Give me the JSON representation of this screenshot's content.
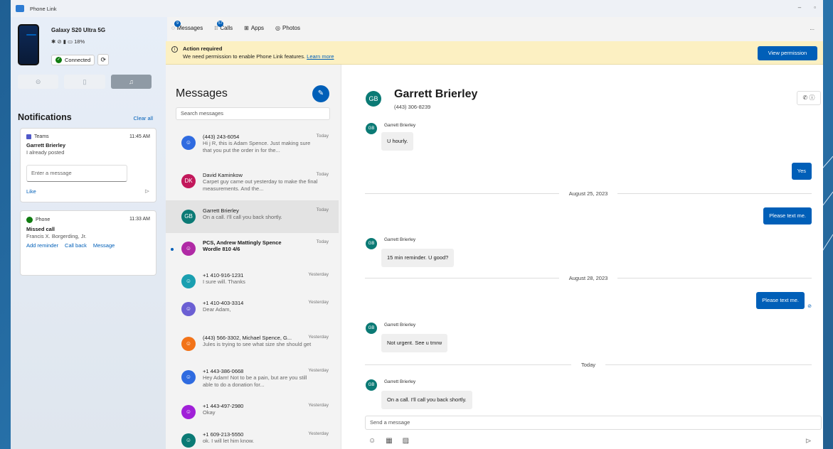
{
  "window": {
    "title": "Phone Link",
    "controls": [
      "–",
      "▫"
    ]
  },
  "device": {
    "name": "Galaxy S20 Ultra 5G",
    "status": "✱ ⊘ ▮ ▭ 18%",
    "connected_label": "Connected",
    "refresh_icon": "⟳",
    "modes": [
      "⊝",
      "▯",
      "♫"
    ]
  },
  "notifications": {
    "title": "Notifications",
    "clear_all": "Clear all",
    "teams": {
      "app": "Teams",
      "time": "11:45 AM",
      "sender": "Garrett Brierley",
      "body": "I already posted",
      "input_placeholder": "Enter a message",
      "like": "Like"
    },
    "phone": {
      "app": "Phone",
      "time": "11:33 AM",
      "title": "Missed call",
      "caller": "Francis X. Borgerding, Jr.",
      "actions": [
        "Add reminder",
        "Call back",
        "Message"
      ]
    }
  },
  "nav": {
    "tabs": [
      {
        "label": "Messages",
        "icon": "💬",
        "badge": "9"
      },
      {
        "label": "Calls",
        "icon": "⁝⁝",
        "badge": "57"
      },
      {
        "label": "Apps",
        "icon": "⊞",
        "badge": ""
      },
      {
        "label": "Photos",
        "icon": "◎",
        "badge": ""
      }
    ],
    "more": "..."
  },
  "banner": {
    "title": "Action required",
    "text": "We need permission to enable Phone Link features.",
    "link": "Learn more",
    "button": "View permission"
  },
  "messages": {
    "heading": "Messages",
    "search_placeholder": "Search messages",
    "conversations": [
      {
        "name": "(443) 243-6054",
        "preview": "Hi j R, this is Adam Spence. Just making sure that you put the order in for the...",
        "date": "Today",
        "avatar": "👤",
        "color": "#2f6be0"
      },
      {
        "name": "David Kaminkow",
        "preview": "Carpet guy came out yesterday to make the final measurements. And the...",
        "date": "Today",
        "avatar": "DK",
        "color": "#c2185b"
      },
      {
        "name": "Garrett Brierley",
        "preview": "On a call.  I'll call you back shortly.",
        "date": "Today",
        "avatar": "GB",
        "color": "#0b7a75"
      },
      {
        "name": "PCS, Andrew Mattingly Spence",
        "preview": "Wordle 810 4/6",
        "date": "Today",
        "avatar": "👥",
        "color": "#b02aa5"
      },
      {
        "name": "+1 410-916-1231",
        "preview": "I sure will. Thanks",
        "date": "Yesterday",
        "avatar": "👤",
        "color": "#1a9fb0"
      },
      {
        "name": "+1 410-403-3314",
        "preview": "Dear Adam,",
        "date": "Yesterday",
        "avatar": "👤",
        "color": "#6b5fd3"
      },
      {
        "name": "(443) 566-3302, Michael Spence, G...",
        "preview": "Jules is trying to see what size she should get",
        "date": "Yesterday",
        "avatar": "👥",
        "color": "#f27318"
      },
      {
        "name": "+1 443-386-0668",
        "preview": "Hey Adam! Not to be a pain, but are you still able to do a donation for...",
        "date": "Yesterday",
        "avatar": "👤",
        "color": "#2f6be0"
      },
      {
        "name": "+1 443-497-2980",
        "preview": "Okay",
        "date": "Yesterday",
        "avatar": "👤",
        "color": "#a020d8"
      },
      {
        "name": "+1 609-213-5550",
        "preview": "ok.  I will let him know.",
        "date": "Yesterday",
        "avatar": "👤",
        "color": "#0b7a75"
      }
    ]
  },
  "chat": {
    "initials": "GB",
    "name": "Garrett Brierley",
    "phone": "(443) 306-8239",
    "call_icons": "✆ ⓘ",
    "sender_label": "Garrett Brierley",
    "msg1": "U hourly.",
    "out1": "Yes",
    "date1": "August 25, 2023",
    "out2": "Please text me.",
    "msg2": "15 min reminder.  U good?",
    "date2": "August 28, 2023",
    "out3": "Please text me.",
    "msg3": "Not urgent. See u tmrw",
    "date3": "Today",
    "msg4": "On a call.  I'll call you back shortly.",
    "compose_placeholder": "Send a message",
    "compose_icons": [
      "☺",
      "▦",
      "▨"
    ],
    "send_icon": "⊳"
  }
}
